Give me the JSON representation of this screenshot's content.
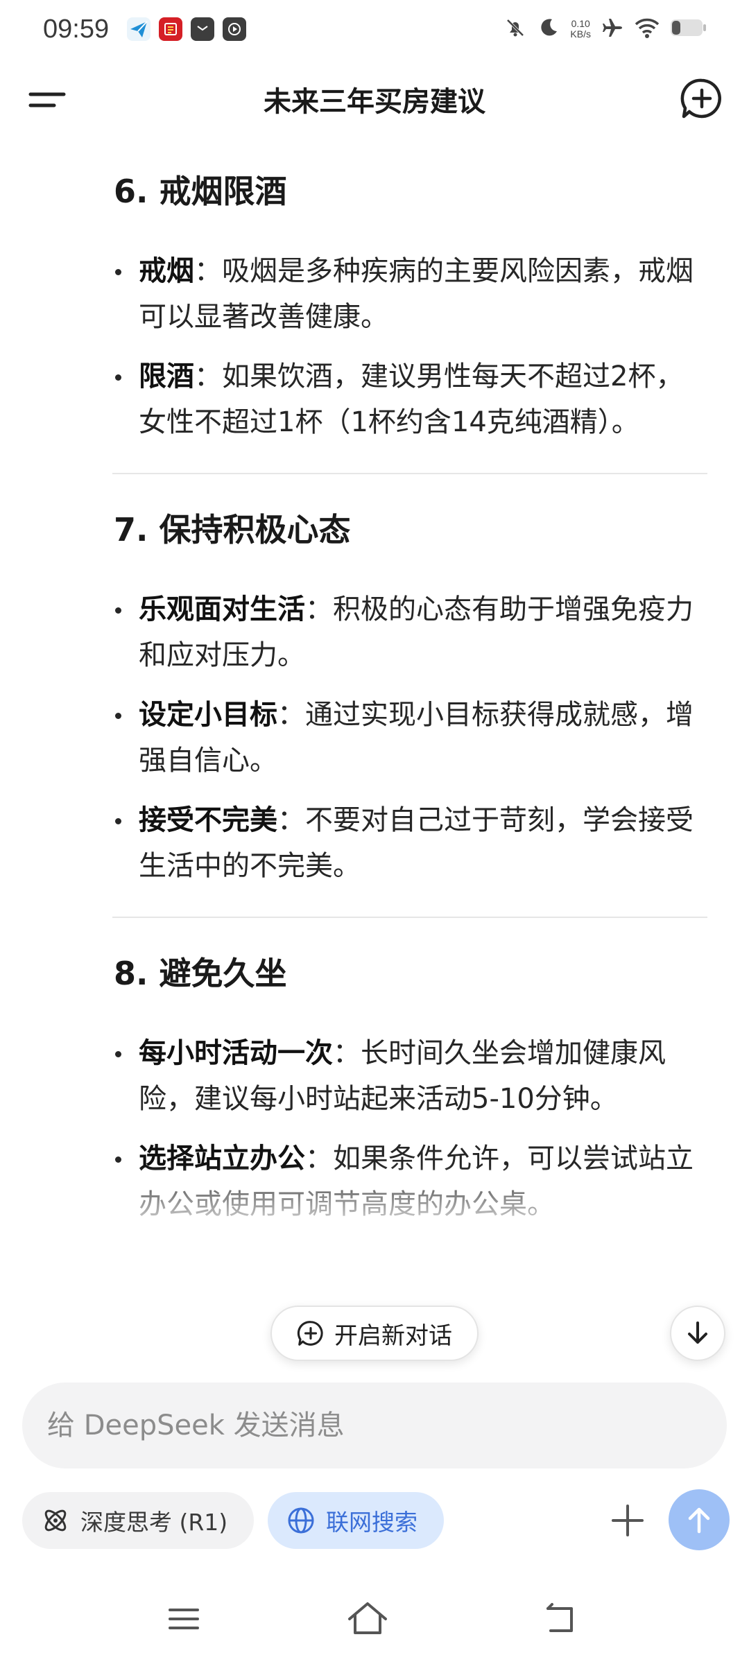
{
  "status_bar": {
    "time": "09:59",
    "net_speed_value": "0.10",
    "net_speed_unit": "KB/s",
    "icons": [
      "send-app-icon",
      "news-app-icon",
      "mail-app-icon",
      "play-app-icon",
      "mute-bell-icon",
      "moon-icon",
      "airplane-icon",
      "wifi-icon",
      "battery-icon"
    ]
  },
  "header": {
    "title": "未来三年买房建议",
    "icons": [
      "menu-icon",
      "new-chat-icon"
    ]
  },
  "content": {
    "sections": [
      {
        "heading": "6.  戒烟限酒",
        "items": [
          {
            "label": "戒烟",
            "text": "：吸烟是多种疾病的主要风险因素，戒烟可以显著改善健康。"
          },
          {
            "label": "限酒",
            "text": "：如果饮酒，建议男性每天不超过2杯，女性不超过1杯（1杯约含14克纯酒精）。"
          }
        ]
      },
      {
        "heading": "7.  保持积极心态",
        "items": [
          {
            "label": "乐观面对生活",
            "text": "：积极的心态有助于增强免疫力和应对压力。"
          },
          {
            "label": "设定小目标",
            "text": "：通过实现小目标获得成就感，增强自信心。"
          },
          {
            "label": "接受不完美",
            "text": "：不要对自己过于苛刻，学会接受生活中的不完美。"
          }
        ]
      },
      {
        "heading": "8.  避免久坐",
        "items": [
          {
            "label": "每小时活动一次",
            "text": "：长时间久坐会增加健康风险，建议每小时站起来活动5-10分钟。"
          },
          {
            "label": "选择站立办公",
            "text": "：如果条件允许，可以尝试站立办公或使用可调节高度的办公桌。"
          }
        ]
      }
    ]
  },
  "floating": {
    "new_chat_label": "开启新对话"
  },
  "composer": {
    "placeholder": "给 DeepSeek 发送消息",
    "value": "",
    "deepthink_label": "深度思考 (R1)",
    "web_search_label": "联网搜索"
  },
  "colors": {
    "accent": "#3b6fd8",
    "send_button": "#9ec0f6",
    "search_chip_bg": "#dbe9fd",
    "input_bg": "#f3f3f4"
  },
  "nav_bar": {
    "icons": [
      "recents-icon",
      "home-icon",
      "back-icon"
    ]
  }
}
